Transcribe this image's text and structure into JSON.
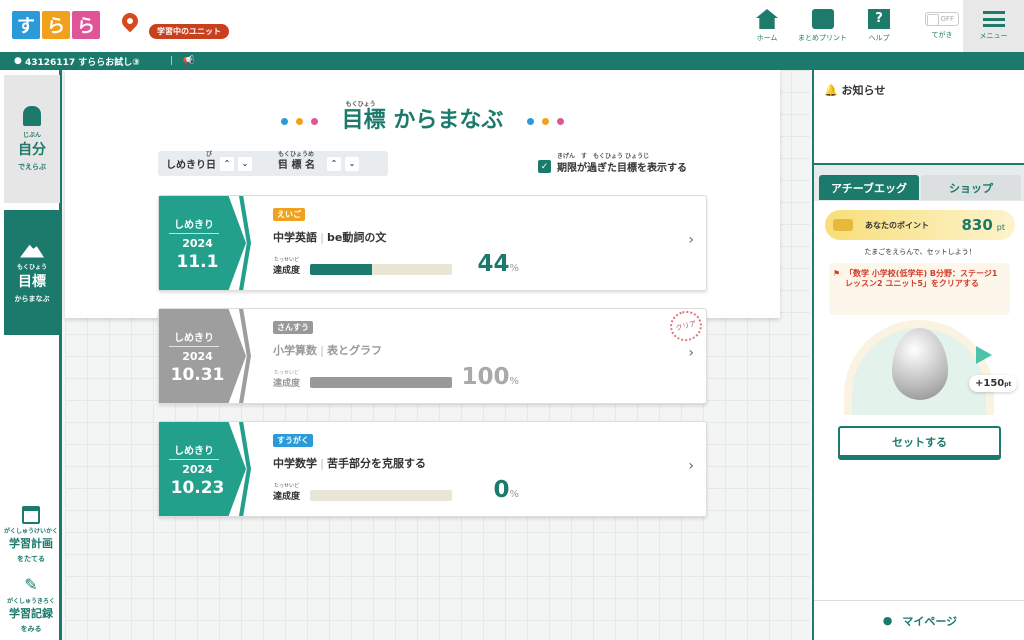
{
  "header": {
    "logo": [
      "す",
      "ら",
      "ら"
    ],
    "logo_colors": [
      "#2a9ad8",
      "#f0a21e",
      "#e05598"
    ],
    "unit_badge": "学習中のユニット",
    "nav": [
      {
        "label": "ホーム",
        "icon": "home-icon"
      },
      {
        "label": "まとめプリント",
        "icon": "printer-icon"
      },
      {
        "label": "ヘルプ",
        "icon": "help-icon"
      },
      {
        "label": "てがき",
        "icon": "toggle"
      },
      {
        "label": "メニュー",
        "icon": "menu-icon"
      }
    ],
    "toggle_state": "OFF"
  },
  "subbar": {
    "user": "43126117 すららお試し③"
  },
  "sidebar": {
    "items": [
      {
        "ruby": "じぶん",
        "label": "自分",
        "sub": "でえらぶ"
      },
      {
        "ruby": "もくひょう",
        "label": "目標",
        "sub": "からまなぶ"
      },
      {
        "ruby": "がくしゅうけいかく",
        "label": "学習計画",
        "sub": "をたてる"
      },
      {
        "ruby": "がくしゅうきろく",
        "label": "学習記録",
        "sub": "をみる"
      }
    ]
  },
  "main": {
    "title_ruby": "もくひょう",
    "title": "目標 からまなぶ",
    "sort": {
      "deadline_ruby": "び",
      "deadline": "しめきり日",
      "name_ruby": "もくひょうめい",
      "name": "目 標 名"
    },
    "show_expired": "期限が過ぎた目標を表示する",
    "show_expired_ruby": "きげん　す　もくひょう ひょうじ",
    "show_expired_checked": true,
    "cards": [
      {
        "deadline_label": "しめきり",
        "year": "2024",
        "date": "11.1",
        "subject": "えいご",
        "subject_color": "#f0a21e",
        "course": "中学英語",
        "unit": "be動詞の文",
        "progress_label": "達成度",
        "progress_ruby": "たっせいど",
        "progress": 44,
        "percent": "%",
        "cleared": false
      },
      {
        "deadline_label": "しめきり",
        "year": "2024",
        "date": "10.31",
        "subject": "さんすう",
        "subject_color": "#999999",
        "course": "小学算数",
        "unit": "表とグラフ",
        "progress_label": "達成度",
        "progress_ruby": "たっせいど",
        "progress": 100,
        "percent": "%",
        "cleared": true,
        "clear_stamp": "クリア"
      },
      {
        "deadline_label": "しめきり",
        "year": "2024",
        "date": "10.23",
        "subject": "すうがく",
        "subject_color": "#2a9ad8",
        "course": "中学数学",
        "unit": "苦手部分を克服する",
        "progress_label": "達成度",
        "progress_ruby": "たっせいど",
        "progress": 0,
        "percent": "%",
        "cleared": false
      }
    ]
  },
  "right": {
    "notice": "お知らせ",
    "tabs": [
      "アチーブエッグ",
      "ショップ"
    ],
    "points_label": "あなたのポイント",
    "points": "830",
    "points_unit": "pt",
    "hint": "たまごをえらんで、セットしよう！",
    "mission": "「数学 小学校(低学年) B分野：ステージ1 レッスン2 ユニット5」をクリアする",
    "egg_cost": "+150",
    "egg_cost_unit": "pt",
    "set_button": "セットする",
    "mypage": "マイページ"
  }
}
